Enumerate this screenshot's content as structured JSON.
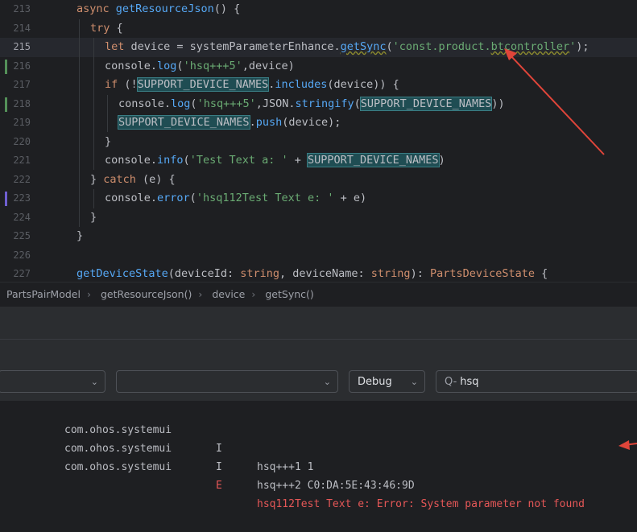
{
  "editor": {
    "lines": [
      {
        "n": "213"
      },
      {
        "n": "214"
      },
      {
        "n": "215"
      },
      {
        "n": "216"
      },
      {
        "n": "217"
      },
      {
        "n": "218"
      },
      {
        "n": "219"
      },
      {
        "n": "220"
      },
      {
        "n": "221"
      },
      {
        "n": "222"
      },
      {
        "n": "223"
      },
      {
        "n": "224"
      },
      {
        "n": "225"
      },
      {
        "n": "226"
      },
      {
        "n": "227"
      }
    ]
  },
  "breadcrumb": [
    "PartsPairModel",
    "getResourceJson()",
    "device",
    "getSync()"
  ],
  "filters": {
    "level": "Debug",
    "search": "hsq"
  },
  "log": [
    {
      "pkg": "com.ohos.systemui",
      "lvl": "I",
      "msg": "hsq+++1 1",
      "error": false
    },
    {
      "pkg": "com.ohos.systemui",
      "lvl": "I",
      "msg": "hsq+++2 C0:DA:5E:43:46:9D",
      "error": false
    },
    {
      "pkg": "com.ohos.systemui",
      "lvl": "E",
      "msg": "hsq112Test Text e: Error: System parameter not found",
      "error": true
    }
  ],
  "colors": {
    "annotation": "#e0453a",
    "error": "#e55757"
  }
}
